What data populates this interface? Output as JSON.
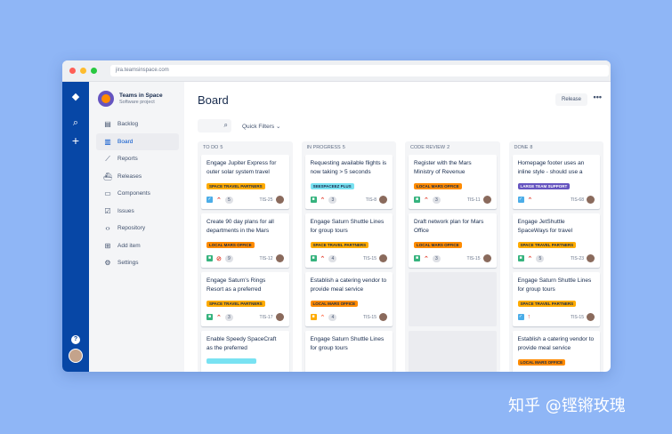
{
  "colors": {
    "background": "#8fb6f6",
    "nav": "#0747a6",
    "story": "#36b37e",
    "task": "#4bade8",
    "bug": "#e5493a",
    "priority_high": "#e5493a",
    "priority_medium": "#ff7452",
    "label_orange": "#ffab00",
    "label_teal": "#79e2f2",
    "label_purple": "#6554c0"
  },
  "browser": {
    "url": "jira.teamsinspace.com"
  },
  "globalnav": {
    "logo_icon": "jira-diamond-icon",
    "search_icon": "search-icon",
    "create_icon": "plus-icon",
    "help_icon": "?",
    "avatar_icon": "user-avatar-icon"
  },
  "sidebar": {
    "project_name": "Teams in Space",
    "project_type": "Software project",
    "items": [
      {
        "label": "Backlog",
        "icon": "▤"
      },
      {
        "label": "Board",
        "icon": "▥"
      },
      {
        "label": "Reports",
        "icon": "⟋"
      },
      {
        "label": "Releases",
        "icon": "⛴"
      },
      {
        "label": "Components",
        "icon": "▭"
      },
      {
        "label": "Issues",
        "icon": "☑"
      },
      {
        "label": "Repository",
        "icon": "‹›"
      },
      {
        "label": "Add item",
        "icon": "⊞"
      },
      {
        "label": "Settings",
        "icon": "⚙"
      }
    ]
  },
  "main": {
    "title": "Board",
    "release_label": "Release",
    "more_label": "•••",
    "search_icon": "⌕",
    "quick_filters": "Quick Filters",
    "chevron": "⌄"
  },
  "columns": [
    {
      "title": "TO DO",
      "count": "5",
      "cards": [
        {
          "text": "Engage Jupiter Express for outer solar system travel",
          "label": "SPACE TRAVEL PARTNERS",
          "label_color": "#ffab00",
          "type": "task",
          "type_color": "#4bade8",
          "type_glyph": "✓",
          "priority_glyph": "⌃",
          "priority_color": "#e5493a",
          "points": "5",
          "key": "TIS-25"
        },
        {
          "text": "Create 90 day plans for all departments in the Mars Office",
          "label": "LOCAL MARS OFFICE",
          "label_color": "#ff8b00",
          "type": "story",
          "type_color": "#36b37e",
          "type_glyph": "■",
          "priority_glyph": "⊘",
          "priority_color": "#e5493a",
          "points": "9",
          "key": "TIS-12"
        },
        {
          "text": "Engage Saturn's Rings Resort as a preferred provider",
          "label": "SPACE TRAVEL PARTNERS",
          "label_color": "#ffab00",
          "type": "story",
          "type_color": "#36b37e",
          "type_glyph": "■",
          "priority_glyph": "⌃",
          "priority_color": "#e5493a",
          "points": "3",
          "key": "TIS-17"
        },
        {
          "text": "Enable Speedy SpaceCraft as the preferred",
          "label": "",
          "label_color": "#79e2f2",
          "type": "",
          "type_color": "",
          "type_glyph": "",
          "priority_glyph": "",
          "priority_color": "",
          "points": "",
          "key": ""
        }
      ]
    },
    {
      "title": "IN PROGRESS",
      "count": "5",
      "cards": [
        {
          "text": "Requesting available flights is now taking > 5 seconds",
          "label": "SEESPACEEZ PLUS",
          "label_color": "#79e2f2",
          "type": "story",
          "type_color": "#36b37e",
          "type_glyph": "■",
          "priority_glyph": "⌃",
          "priority_color": "#e5493a",
          "points": "3",
          "key": "TIS-8"
        },
        {
          "text": "Engage Saturn Shuttle Lines for group tours",
          "label": "SPACE TRAVEL PARTNERS",
          "label_color": "#ffab00",
          "type": "story",
          "type_color": "#36b37e",
          "type_glyph": "■",
          "priority_glyph": "⌃",
          "priority_color": "#e5493a",
          "points": "4",
          "key": "TIS-15"
        },
        {
          "text": "Establish a catering vendor to provide meal service",
          "label": "LOCAL MARS OFFICE",
          "label_color": "#ff8b00",
          "type": "story",
          "type_color": "#ffab00",
          "type_glyph": "■",
          "priority_glyph": "⌃",
          "priority_color": "#ff7452",
          "points": "4",
          "key": "TIS-15"
        },
        {
          "text": "Engage Saturn Shuttle Lines for group tours",
          "label": "",
          "label_color": "",
          "type": "",
          "type_color": "",
          "type_glyph": "",
          "priority_glyph": "",
          "priority_color": "",
          "points": "",
          "key": ""
        }
      ]
    },
    {
      "title": "CODE REVIEW",
      "count": "2",
      "cards": [
        {
          "text": "Register with the Mars Ministry of Revenue",
          "label": "LOCAL MARS OFFICE",
          "label_color": "#ff8b00",
          "type": "story",
          "type_color": "#36b37e",
          "type_glyph": "■",
          "priority_glyph": "⌃",
          "priority_color": "#e5493a",
          "points": "3",
          "key": "TIS-11"
        },
        {
          "text": "Draft network plan for Mars Office",
          "label": "LOCAL MARS OFFICE",
          "label_color": "#ff8b00",
          "type": "story",
          "type_color": "#36b37e",
          "type_glyph": "■",
          "priority_glyph": "⌃",
          "priority_color": "#e5493a",
          "points": "3",
          "key": "TIS-15"
        }
      ]
    },
    {
      "title": "DONE",
      "count": "8",
      "cards": [
        {
          "text": "Homepage footer uses an inline style - should use a class",
          "label": "LARGE TEAM SUPPORT",
          "label_color": "#6554c0",
          "type": "task",
          "type_color": "#4bade8",
          "type_glyph": "✓",
          "priority_glyph": "⌃",
          "priority_color": "#e5493a",
          "points": "",
          "key": "TIS-68"
        },
        {
          "text": "Engage JetShuttle SpaceWays for travel",
          "label": "SPACE TRAVEL PARTNERS",
          "label_color": "#ffab00",
          "type": "story",
          "type_color": "#36b37e",
          "type_glyph": "■",
          "priority_glyph": "⌃",
          "priority_color": "#e5493a",
          "points": "5",
          "key": "TIS-23"
        },
        {
          "text": "Engage Saturn Shuttle Lines for group tours",
          "label": "SPACE TRAVEL PARTNERS",
          "label_color": "#ffab00",
          "type": "task",
          "type_color": "#4bade8",
          "type_glyph": "✓",
          "priority_glyph": "↑",
          "priority_color": "#e5493a",
          "points": "",
          "key": "TIS-15"
        },
        {
          "text": "Establish a catering vendor to provide meal service",
          "label": "LOCAL MARS OFFICE",
          "label_color": "#ff8b00",
          "type": "",
          "type_color": "",
          "type_glyph": "",
          "priority_glyph": "",
          "priority_color": "",
          "points": "",
          "key": ""
        }
      ]
    }
  ],
  "watermark": "知乎 @铿锵玫瑰"
}
